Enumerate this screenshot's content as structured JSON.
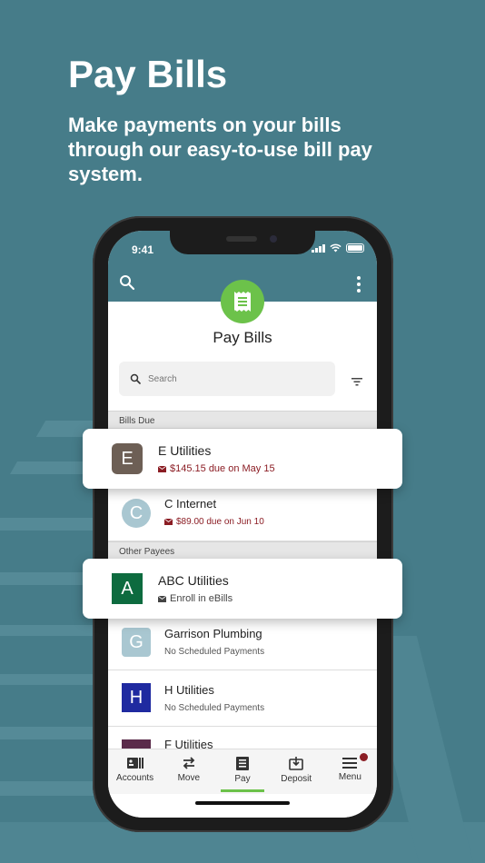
{
  "hero": {
    "title": "Pay Bills",
    "subtitle": "Make payments on your bills through our easy-to-use bill pay system."
  },
  "status_bar": {
    "time": "9:41"
  },
  "header": {
    "title": "Pay Bills",
    "icon": "receipt-icon"
  },
  "search": {
    "placeholder": "Search"
  },
  "sections": {
    "bills_due": "Bills Due",
    "other_payees": "Other Payees"
  },
  "bills_due": [
    {
      "initial": "E",
      "name": "E Utilities",
      "status": "$145.15 due on May 15",
      "color": "#6d5f55"
    },
    {
      "initial": "C",
      "name": "C Internet",
      "status": "$89.00 due on Jun 10",
      "color": "#a9c7d1"
    }
  ],
  "other_payees": [
    {
      "initial": "A",
      "name": "ABC Utilities",
      "status": "Enroll in eBills",
      "color": "#0d6b3f"
    },
    {
      "initial": "G",
      "name": "Garrison Plumbing",
      "status": "No Scheduled Payments",
      "color": "#a9c7d1"
    },
    {
      "initial": "H",
      "name": "H Utilities",
      "status": "No Scheduled Payments",
      "color": "#1f2aa0"
    },
    {
      "initial": "F",
      "name": "F Utilities",
      "status": "",
      "color": "#5a2b4a"
    }
  ],
  "tabs": [
    {
      "label": "Accounts",
      "icon": "accounts-icon"
    },
    {
      "label": "Move",
      "icon": "transfer-icon"
    },
    {
      "label": "Pay",
      "icon": "pay-icon",
      "active": true
    },
    {
      "label": "Deposit",
      "icon": "deposit-icon"
    },
    {
      "label": "Menu",
      "icon": "menu-icon"
    }
  ],
  "colors": {
    "background": "#467c89",
    "accent": "#6cc24a",
    "due": "#8b1d24"
  }
}
